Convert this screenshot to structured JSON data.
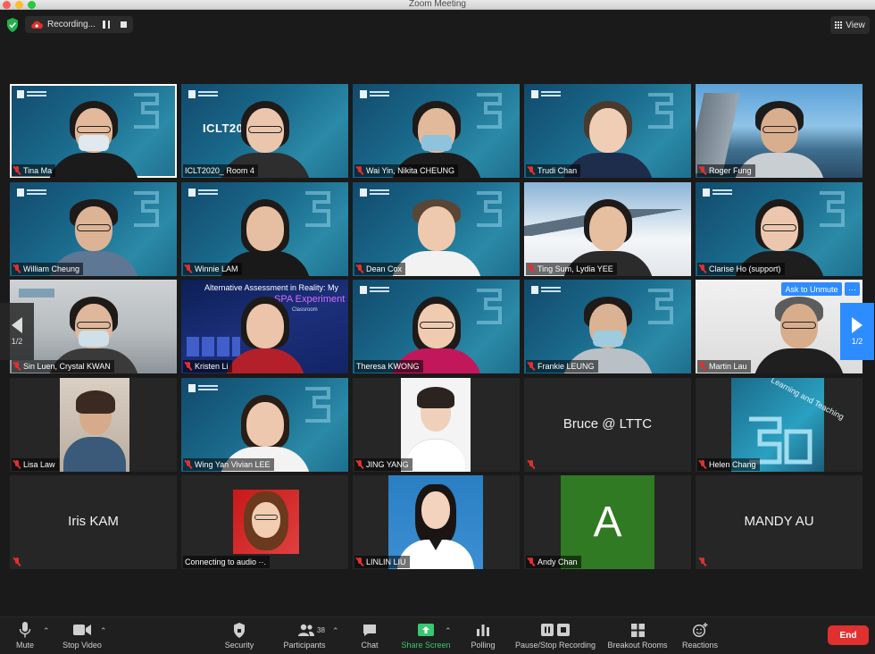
{
  "window": {
    "title": "Zoom Meeting"
  },
  "topbar": {
    "recording_label": "Recording...",
    "view_label": "View"
  },
  "tiles": [
    {
      "name": "Tina Ma"
    },
    {
      "name": "ICLT2020_ Room 4",
      "slide_text": "ICLT20   4"
    },
    {
      "name": "Wai Yin, Nikita CHEUNG"
    },
    {
      "name": "Trudi Chan"
    },
    {
      "name": "Roger Fung"
    },
    {
      "name": "William Cheung"
    },
    {
      "name": "Winnie LAM"
    },
    {
      "name": "Dean Cox"
    },
    {
      "name": "Ting Sum, Lydia YEE"
    },
    {
      "name": "Clarise Ho (support)"
    },
    {
      "name": "Sin Luen, Crystal KWAN"
    },
    {
      "name": "Kristen Li",
      "slide_line1": "Alternative Assessment in Reality: My",
      "slide_line2": "SPA Experiment",
      "slide_line3": "Classroom"
    },
    {
      "name": "Theresa KWONG"
    },
    {
      "name": "Frankie LEUNG"
    },
    {
      "name": "Martin Lau"
    },
    {
      "name": "Lisa Law"
    },
    {
      "name": "Wing Yan Vivian LEE"
    },
    {
      "name": "JING YANG"
    },
    {
      "name": "Bruce @ LTTC",
      "center": "Bruce @ LTTC"
    },
    {
      "name": "Helen Chang",
      "poster_text": "Learning and Teaching"
    },
    {
      "name": "Iris KAM",
      "center": "Iris KAM"
    },
    {
      "name": "Connecting to audio ··."
    },
    {
      "name": "LINLIN LIU"
    },
    {
      "name": "Andy Chan",
      "avatar_letter": "A"
    },
    {
      "name": "MANDY AU",
      "center": "MANDY AU"
    }
  ],
  "overlay": {
    "ask_unmute": "Ask to Unmute",
    "more": "···"
  },
  "pager": {
    "left": "1/2",
    "right": "1/2"
  },
  "toolbar": {
    "mute": "Mute",
    "stop_video": "Stop Video",
    "security": "Security",
    "participants": "Participants",
    "participants_count": "38",
    "chat": "Chat",
    "share_screen": "Share Screen",
    "polling": "Polling",
    "recording": "Pause/Stop Recording",
    "breakout": "Breakout Rooms",
    "reactions": "Reactions",
    "end": "End"
  },
  "colors": {
    "accent": "#2d8cff",
    "end": "#e0302f",
    "share": "#37c871",
    "mic_off": "#e0302f"
  }
}
